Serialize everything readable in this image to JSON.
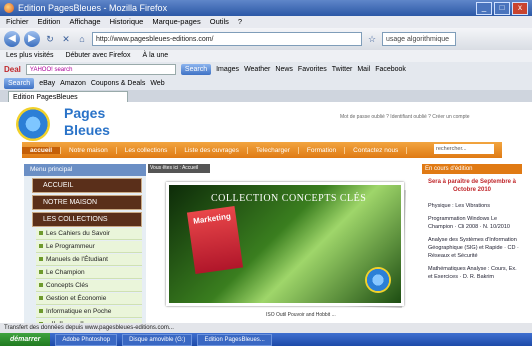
{
  "window": {
    "title": "Edition PagesBleues - Mozilla Firefox",
    "buttons": [
      "_",
      "□",
      "x"
    ]
  },
  "menu": [
    "Fichier",
    "Edition",
    "Affichage",
    "Historique",
    "Marque-pages",
    "Outils",
    "?"
  ],
  "nav": {
    "url": "http://www.pagesbleues-editions.com/",
    "search_placeholder": "usage algorithmique"
  },
  "bookmarks": [
    "Les plus visités",
    "Débuter avec Firefox",
    "À la une"
  ],
  "toolbar1": {
    "brand": "Deal",
    "yahoo": "YAHOO! search",
    "search_label": "Search",
    "items": [
      "Images",
      "Weather",
      "News",
      "Favorites",
      "Twitter",
      "Mail",
      "Facebook"
    ]
  },
  "toolbar2": {
    "search_label": "Search",
    "items": [
      "eBay",
      "Amazon",
      "Coupons & Deals",
      "Web"
    ]
  },
  "tab": {
    "label": "Edition PagesBleues"
  },
  "site": {
    "logo_line1": "Pages",
    "logo_line2": "Bleues",
    "signin": "Mot de passe oublié ?   Identifiant oublié ?   Créer un compte",
    "nav": [
      "accueil",
      "Notre maison",
      "Les collections",
      "Liste des ouvrages",
      "Telecharger",
      "Formation",
      "Contactez nous"
    ],
    "search": "rechercher..."
  },
  "sidebar": {
    "head": "Menu principal",
    "top": [
      "ACCUEIL",
      "NOTRE MAISON",
      "LES COLLECTIONS"
    ],
    "items": [
      "Les Cahiers du Savoir",
      "Le Programmeur",
      "Manuels de l'Étudiant",
      "Le Champion",
      "Concepts Clés",
      "Gestion et Économie",
      "Informatique en Poche",
      "التسيير المالي"
    ]
  },
  "center": {
    "crumb": "Vous êtes ici : Accueil",
    "hero_title": "COLLECTION CONCEPTS CLÉS",
    "book": "Marketing",
    "caption": "ISO Outil Pouvoir and Hobbit ..."
  },
  "right": {
    "head": "En cours d'édition",
    "sub": "Sera à paraître de Septembre à Octobre 2010",
    "list": [
      "Physique : Les Vibrations",
      "Programmation Windows Le Champion · Cli 2008 · N. 10/2010",
      "Analyse des Systèmes d'Information Géographique (SIG) et Rapide · CD · Réseaux et Sécurité",
      "Mathématiques Analyse : Cours, Ex. et Exercices · D. R. Bakrim"
    ]
  },
  "statusbar": "Transfert des données depuis www.pagesbleues-editions.com...",
  "taskbar": {
    "start": "démarrer",
    "tasks": [
      "Adobe Photoshop",
      "Disque amovible (G:)",
      "Edition PagesBleues..."
    ]
  }
}
